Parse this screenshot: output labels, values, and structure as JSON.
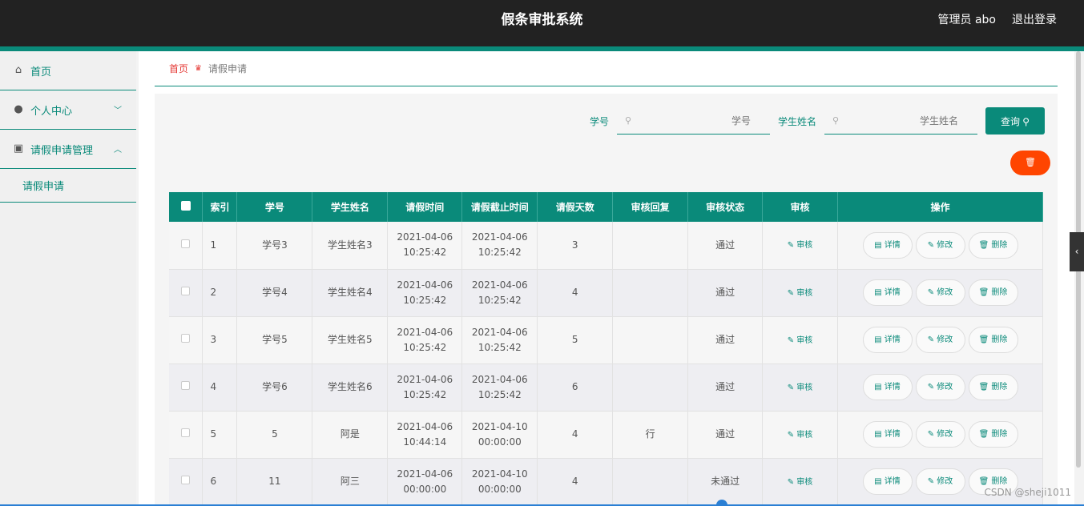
{
  "header": {
    "title": "假条审批系统",
    "user": "管理员 abo",
    "logout": "退出登录"
  },
  "sidebar": {
    "items": [
      {
        "label": "首页",
        "icon": "home-icon"
      },
      {
        "label": "个人中心",
        "icon": "user-icon",
        "arrow": "﹀"
      },
      {
        "label": "请假申请管理",
        "icon": "clipboard-icon",
        "arrow": "︿"
      }
    ],
    "sub_item": "请假申请"
  },
  "breadcrumb": {
    "home": "首页",
    "current": "请假申请"
  },
  "search": {
    "student_no_label": "学号",
    "student_no_placeholder": "学号",
    "student_name_label": "学生姓名",
    "student_name_placeholder": "学生姓名",
    "query_label": "查询 ⚲"
  },
  "delete_icon": "🗑",
  "table": {
    "headers": [
      "索引",
      "学号",
      "学生姓名",
      "请假时间",
      "请假截止时间",
      "请假天数",
      "审核回复",
      "审核状态",
      "审核",
      "操作"
    ],
    "rows": [
      {
        "idx": "1",
        "no": "学号3",
        "name": "学生姓名3",
        "start1": "2021-04-06",
        "start2": "10:25:42",
        "end1": "2021-04-06",
        "end2": "10:25:42",
        "days": "3",
        "reply": "",
        "status": "通过"
      },
      {
        "idx": "2",
        "no": "学号4",
        "name": "学生姓名4",
        "start1": "2021-04-06",
        "start2": "10:25:42",
        "end1": "2021-04-06",
        "end2": "10:25:42",
        "days": "4",
        "reply": "",
        "status": "通过"
      },
      {
        "idx": "3",
        "no": "学号5",
        "name": "学生姓名5",
        "start1": "2021-04-06",
        "start2": "10:25:42",
        "end1": "2021-04-06",
        "end2": "10:25:42",
        "days": "5",
        "reply": "",
        "status": "通过"
      },
      {
        "idx": "4",
        "no": "学号6",
        "name": "学生姓名6",
        "start1": "2021-04-06",
        "start2": "10:25:42",
        "end1": "2021-04-06",
        "end2": "10:25:42",
        "days": "6",
        "reply": "",
        "status": "通过"
      },
      {
        "idx": "5",
        "no": "5",
        "name": "阿是",
        "start1": "2021-04-06",
        "start2": "10:44:14",
        "end1": "2021-04-10",
        "end2": "00:00:00",
        "days": "4",
        "reply": "行",
        "status": "通过"
      },
      {
        "idx": "6",
        "no": "11",
        "name": "阿三",
        "start1": "2021-04-06",
        "start2": "00:00:00",
        "end1": "2021-04-10",
        "end2": "00:00:00",
        "days": "4",
        "reply": "",
        "status": "未通过"
      }
    ],
    "audit_label": "✎ 审核",
    "ops": {
      "detail": "▤ 详情",
      "edit": "✎ 修改",
      "delete": "🗑 删除"
    }
  },
  "watermark": "CSDN @sheji1011"
}
